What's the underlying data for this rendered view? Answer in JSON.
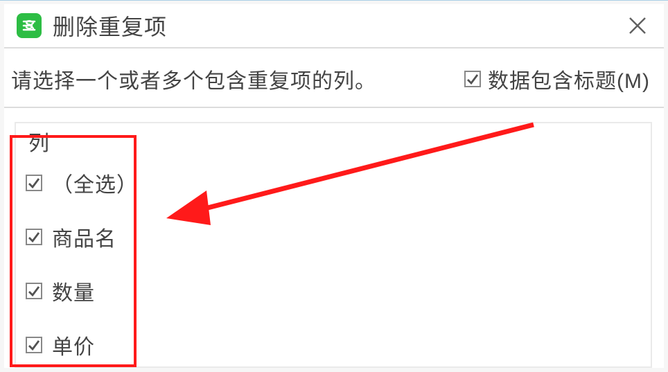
{
  "dialog": {
    "title": "删除重复项",
    "prompt": "请选择一个或者多个包含重复项的列。",
    "headers_checkbox_label": "数据包含标题(M)",
    "headers_checked": true
  },
  "columns": {
    "header": "列",
    "items": [
      {
        "label": "（全选）",
        "checked": true
      },
      {
        "label": "商品名",
        "checked": true
      },
      {
        "label": "数量",
        "checked": true
      },
      {
        "label": "单价",
        "checked": true
      }
    ]
  }
}
